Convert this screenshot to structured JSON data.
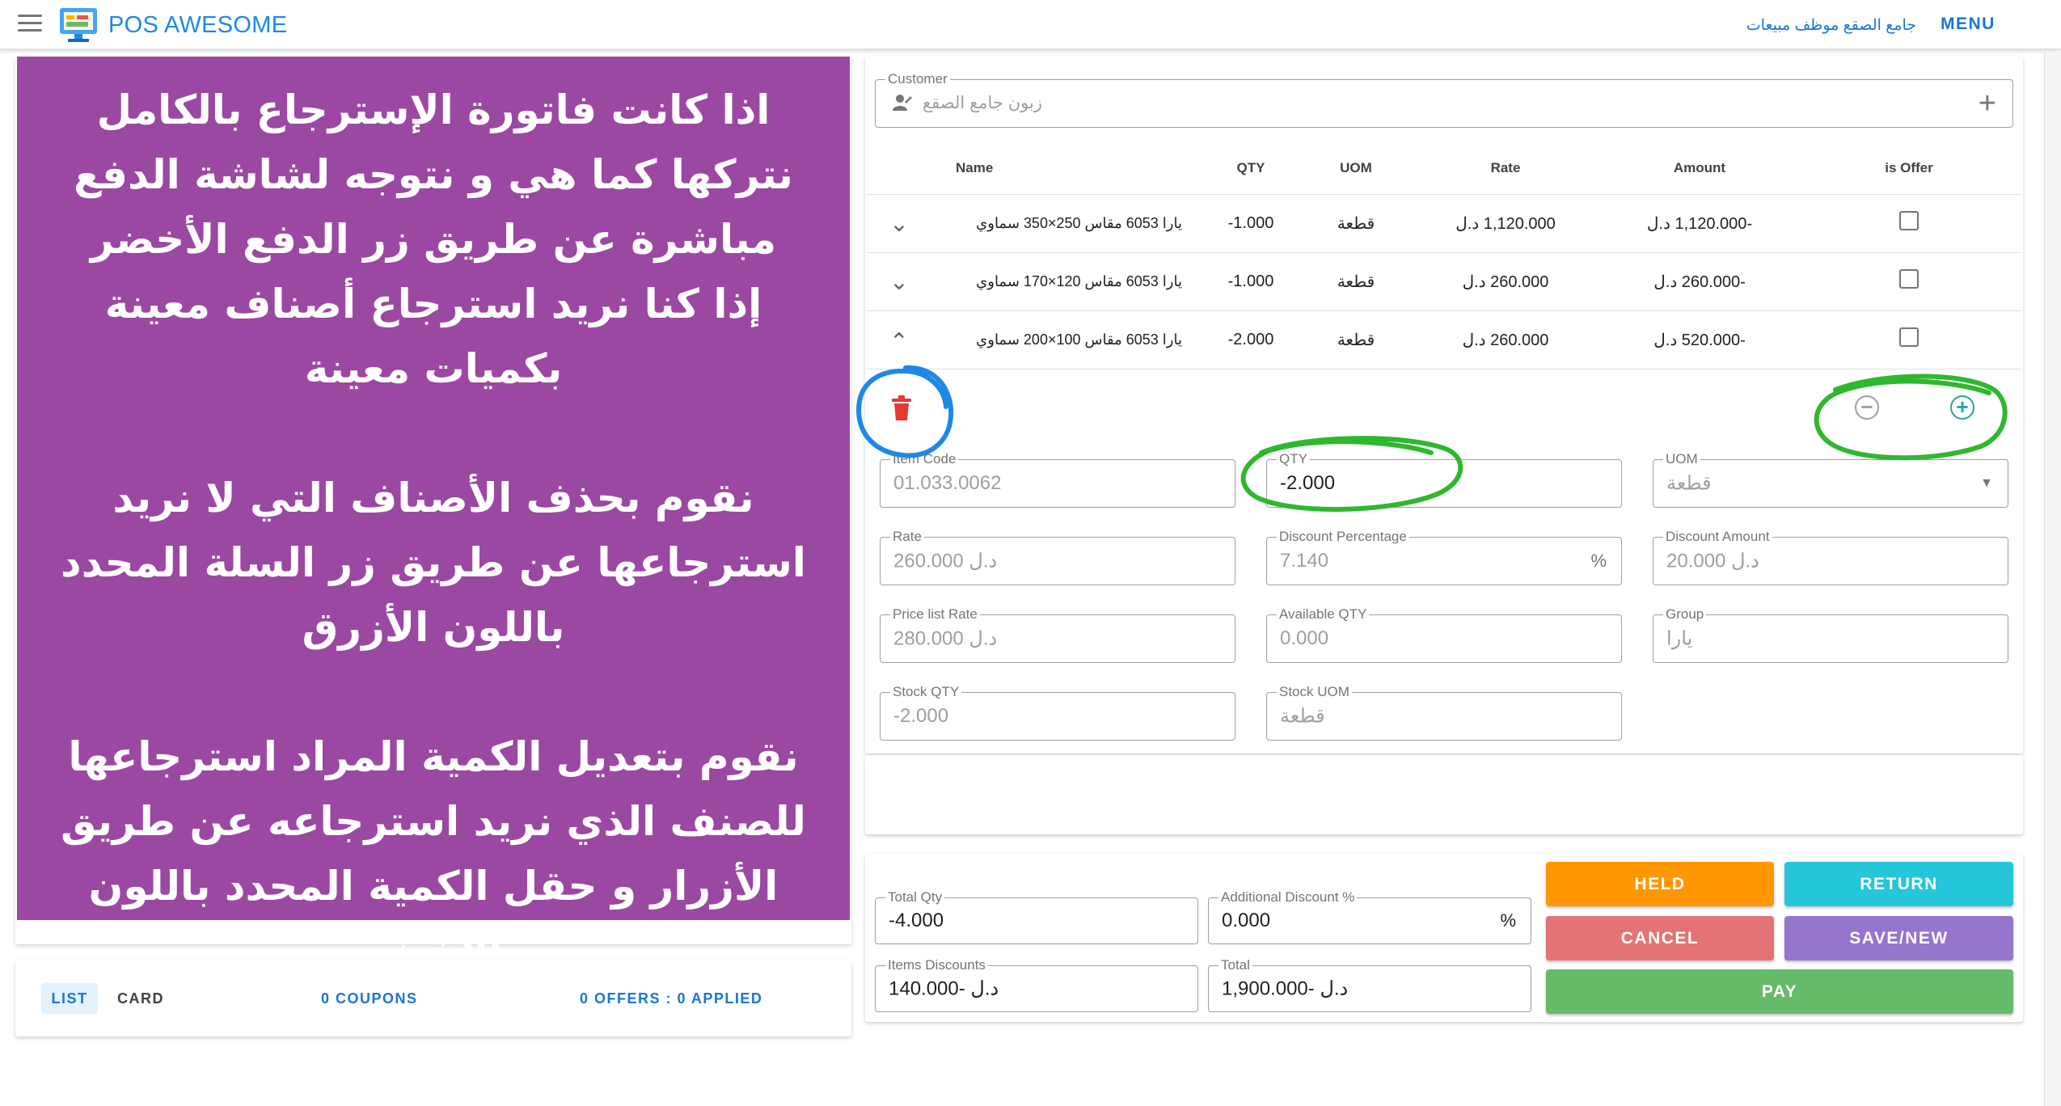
{
  "app": {
    "title": "POS AWESOME",
    "user_label": "جامع الصقع موظف مبيعات",
    "menu_label": "MENU"
  },
  "instructions": {
    "p1": "اذا كانت فاتورة الإسترجاع بالكامل نتركها كما هي و نتوجه لشاشة الدفع مباشرة عن طريق زر الدفع الأخضر",
    "p2": "إذا كنا نريد استرجاع أصناف معينة بكميات معينة",
    "p3": "نقوم بحذف الأصناف التي لا نريد استرجاعها عن طريق زر السلة المحدد باللون الأزرق",
    "p4": "نقوم بتعديل الكمية المراد استرجاعها للصنف الذي نريد استرجاعه عن طريق الأزرار و حقل الكمية المحدد باللون الأخضر"
  },
  "bottom_bar": {
    "list_tab": "LIST",
    "card_tab": "CARD",
    "coupons": "0 COUPONS",
    "offers": "0 OFFERS : 0 APPLIED"
  },
  "customer": {
    "label": "Customer",
    "value": "زبون جامع الصقع"
  },
  "items_table": {
    "headers": [
      "Name",
      "QTY",
      "UOM",
      "Rate",
      "Amount",
      "is Offer"
    ],
    "rows": [
      {
        "name": "يارا 6053 مقاس 250×350 سماوي",
        "qty": "-1.000",
        "uom": "قطعة",
        "rate": "1,120.000 د.ل",
        "amount": "-1,120.000 د.ل",
        "is_offer": false,
        "expanded": false
      },
      {
        "name": "يارا 6053 مقاس 120×170 سماوي",
        "qty": "-1.000",
        "uom": "قطعة",
        "rate": "260.000 د.ل",
        "amount": "-260.000 د.ل",
        "is_offer": false,
        "expanded": false
      },
      {
        "name": "يارا 6053 مقاس 100×200 سماوي",
        "qty": "-2.000",
        "uom": "قطعة",
        "rate": "260.000 د.ل",
        "amount": "-520.000 د.ل",
        "is_offer": false,
        "expanded": true
      }
    ]
  },
  "item_detail": {
    "item_code": {
      "label": "Item Code",
      "value": "01.033.0062"
    },
    "qty": {
      "label": "QTY",
      "value": "-2.000"
    },
    "uom": {
      "label": "UOM",
      "value": "قطعة"
    },
    "rate": {
      "label": "Rate",
      "value": "د.ل 260.000"
    },
    "discount_percentage": {
      "label": "Discount Percentage",
      "value": "7.140",
      "suffix": "%"
    },
    "discount_amount": {
      "label": "Discount Amount",
      "value": "د.ل 20.000"
    },
    "price_list_rate": {
      "label": "Price list Rate",
      "value": "د.ل 280.000"
    },
    "available_qty": {
      "label": "Available QTY",
      "value": "0.000"
    },
    "group": {
      "label": "Group",
      "value": "يارا"
    },
    "stock_qty": {
      "label": "Stock QTY",
      "value": "-2.000"
    },
    "stock_uom": {
      "label": "Stock UOM",
      "value": "قطعة"
    }
  },
  "totals": {
    "total_qty": {
      "label": "Total Qty",
      "value": "-4.000"
    },
    "additional_discount": {
      "label": "Additional Discount %",
      "value": "0.000",
      "suffix": "%"
    },
    "items_discounts": {
      "label": "Items Discounts",
      "value": "د.ل -140.000"
    },
    "total": {
      "label": "Total",
      "value": "د.ل -1,900.000"
    }
  },
  "actions": {
    "held": "HELD",
    "return": "RETURN",
    "cancel": "CANCEL",
    "save_new": "SAVE/NEW",
    "pay": "PAY"
  },
  "colors": {
    "purple_panel": "#9b48a2",
    "held": "#ff9800",
    "return": "#26c6da",
    "cancel": "#e57373",
    "save_new": "#9575cd",
    "pay": "#66bb6a",
    "annotation_blue": "#1e88e5",
    "annotation_green": "#2eb82e",
    "delete_icon": "#e53935"
  }
}
